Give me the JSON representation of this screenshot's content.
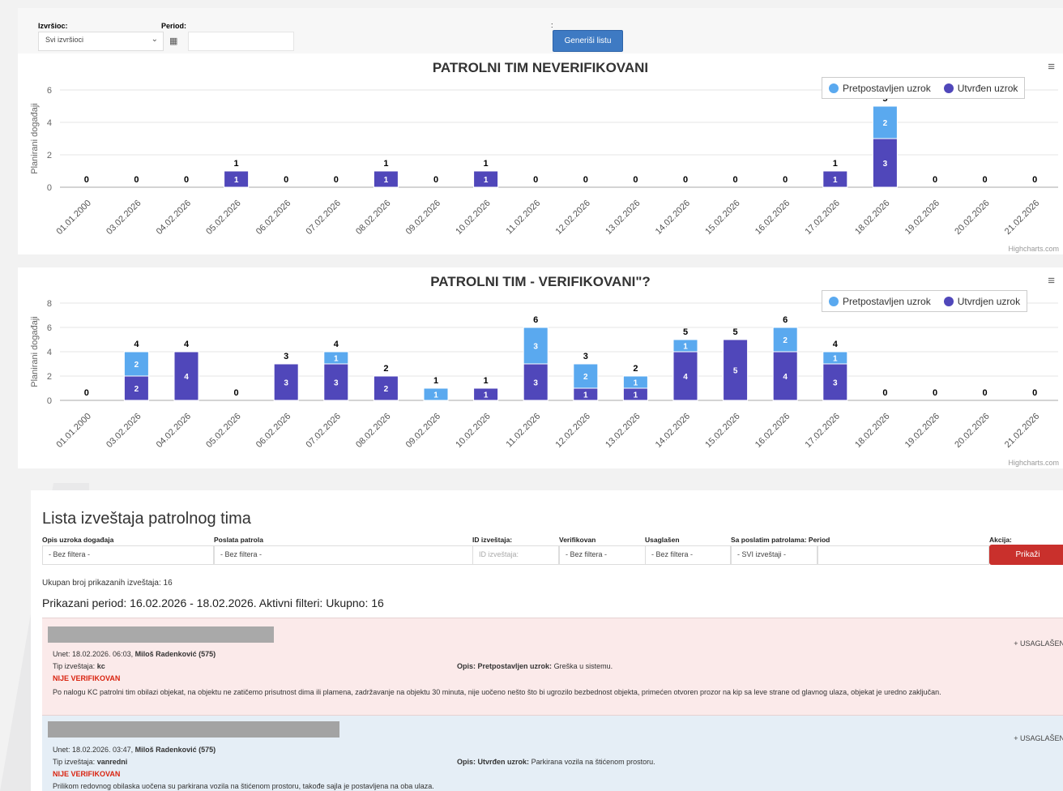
{
  "filters_top": {
    "executor_label": "Izvršioc:",
    "executor_value": "Svi izvršioci",
    "period_label": "Period:",
    "colon": ":",
    "generate_label": "Generiši listu"
  },
  "legend": {
    "assumed": "Pretpostavljen uzrok",
    "determined1": "Utvrđen uzrok",
    "determined2": "Utvrdjen uzrok"
  },
  "colors": {
    "assumed": "#5aa9ef",
    "determined": "#5047ba",
    "danger": "#c9302c",
    "primary": "#3e7ac3"
  },
  "credits": "Highcharts.com",
  "chart_data": [
    {
      "type": "bar",
      "title": "PATROLNI TIM NEVERIFIKOVANI",
      "ylabel": "Planirani događaji",
      "ylim": [
        0,
        6
      ],
      "yticks": [
        0,
        2,
        4,
        6
      ],
      "stacked": true,
      "categories": [
        "01.01.2000",
        "03.02.2026",
        "04.02.2026",
        "05.02.2026",
        "06.02.2026",
        "07.02.2026",
        "08.02.2026",
        "09.02.2026",
        "10.02.2026",
        "11.02.2026",
        "12.02.2026",
        "13.02.2026",
        "14.02.2026",
        "15.02.2026",
        "16.02.2026",
        "17.02.2026",
        "18.02.2026",
        "19.02.2026",
        "20.02.2026",
        "21.02.2026"
      ],
      "series": [
        {
          "name": "Pretpostavljen uzrok",
          "values": [
            0,
            0,
            0,
            0,
            0,
            0,
            0,
            0,
            0,
            0,
            0,
            0,
            0,
            0,
            0,
            0,
            2,
            0,
            0,
            0
          ]
        },
        {
          "name": "Utvrđen uzrok",
          "values": [
            0,
            0,
            0,
            1,
            0,
            0,
            1,
            0,
            1,
            0,
            0,
            0,
            0,
            0,
            0,
            1,
            3,
            0,
            0,
            0
          ]
        }
      ],
      "totals": [
        0,
        0,
        0,
        1,
        0,
        0,
        1,
        0,
        1,
        0,
        0,
        0,
        0,
        0,
        0,
        1,
        5,
        0,
        0,
        0
      ],
      "legend": "top-right"
    },
    {
      "type": "bar",
      "title": "PATROLNI TIM - VERIFIKOVANI\"?",
      "ylabel": "Planirani događaji",
      "ylim": [
        0,
        8
      ],
      "yticks": [
        0,
        2,
        4,
        6,
        8
      ],
      "stacked": true,
      "categories": [
        "01.01.2000",
        "03.02.2026",
        "04.02.2026",
        "05.02.2026",
        "06.02.2026",
        "07.02.2026",
        "08.02.2026",
        "09.02.2026",
        "10.02.2026",
        "11.02.2026",
        "12.02.2026",
        "13.02.2026",
        "14.02.2026",
        "15.02.2026",
        "16.02.2026",
        "17.02.2026",
        "18.02.2026",
        "19.02.2026",
        "20.02.2026",
        "21.02.2026"
      ],
      "series": [
        {
          "name": "Pretpostavljen uzrok",
          "values": [
            0,
            2,
            0,
            0,
            0,
            1,
            0,
            1,
            0,
            3,
            2,
            1,
            1,
            0,
            2,
            1,
            0,
            0,
            0,
            0
          ]
        },
        {
          "name": "Utvrdjen uzrok",
          "values": [
            0,
            2,
            4,
            0,
            3,
            3,
            2,
            0,
            1,
            3,
            1,
            1,
            4,
            5,
            4,
            3,
            0,
            0,
            0,
            0
          ]
        }
      ],
      "totals": [
        0,
        4,
        4,
        0,
        3,
        4,
        2,
        1,
        1,
        6,
        3,
        2,
        5,
        5,
        6,
        4,
        0,
        0,
        0,
        0
      ],
      "legend": "top-right"
    }
  ],
  "list": {
    "title": "Lista izveštaja patrolnog tima",
    "filters": {
      "cause_label": "Opis uzroka događaja",
      "cause_value": "- Bez filtera -",
      "patrol_label": "Poslata patrola",
      "patrol_value": "- Bez filtera -",
      "id_label": "ID izveštaja:",
      "id_placeholder": "ID izveštaja:",
      "verified_label": "Verifikovan",
      "verified_value": "- Bez filtera -",
      "harmonized_label": "Usaglašen",
      "harmonized_value": "- Bez filtera -",
      "sent_label": "Sa poslatim patrolama:",
      "sent_value": "- SVI izveštaji -",
      "period_label": "Period",
      "action_label": "Akcija:",
      "show_label": "Prikaži"
    },
    "count_text": "Ukupan broj prikazanih izveštaja: 16",
    "period_text": "Prikazani period: 16.02.2026 - 18.02.2026. Aktivni filteri: Ukupno: 16",
    "reports": [
      {
        "entered_prefix": "Unet: 18.02.2026. 06:03,",
        "author": "Miloš Radenković (575)",
        "type_prefix": "Tip izveštaja:",
        "type": "kc",
        "status": "NIJE VERIFIKOVAN",
        "opis_label": "Opis:",
        "cause_label": "Pretpostavljen uzrok:",
        "cause_text": "Greška u sistemu.",
        "description": "Po nalogu KC patrolni tim obilazi objekat, na objektu ne zatičemo prisutnost dima ili plamena, zadržavanje na objektu 30 minuta, nije uočeno nešto što bi ugrozilo bezbednost objekta, primećen otvoren prozor na kip sa leve strane od glavnog ulaza, objekat je uredno zaključan.",
        "usag": "+ USAGLAŠEN"
      },
      {
        "entered_prefix": "Unet: 18.02.2026. 03:47,",
        "author": "Miloš Radenković (575)",
        "type_prefix": "Tip izveštaja:",
        "type": "vanredni",
        "status": "NIJE VERIFIKOVAN",
        "opis_label": "Opis:",
        "cause_label": "Utvrđen uzrok:",
        "cause_text": "Parkirana vozila na štićenom prostoru.",
        "description": "Prilikom redovnog obilaska uočena su parkirana vozila na štićenom prostoru, takođe sajla je postavljena na oba ulaza.",
        "usag": "+ USAGLAŠEN"
      }
    ]
  }
}
